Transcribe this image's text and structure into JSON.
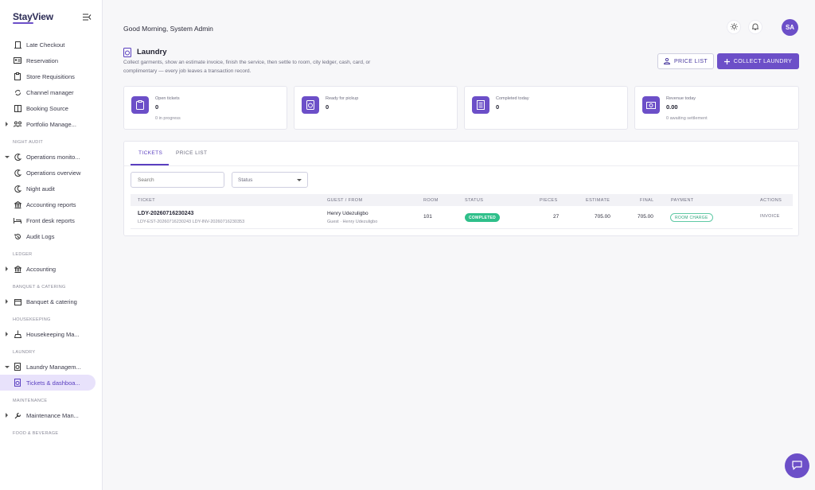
{
  "brand": {
    "logo_text": "StayView",
    "accent": "#6c4fc8"
  },
  "sidebar": {
    "top_items": [
      {
        "label": "Late Checkout",
        "icon": "door-icon"
      },
      {
        "label": "Reservation",
        "icon": "id-card-icon"
      },
      {
        "label": "Store Requisitions",
        "icon": "clipboard-icon"
      },
      {
        "label": "Channel manager",
        "icon": "sync-icon"
      },
      {
        "label": "Booking Source",
        "icon": "book-icon"
      },
      {
        "label": "Portfolio Manage...",
        "icon": "people-icon"
      }
    ],
    "sections": [
      {
        "title": "NIGHT AUDIT",
        "items": [
          {
            "label": "Operations monito...",
            "icon": "moon-icon"
          },
          {
            "label": "Operations overview",
            "icon": "moon-icon"
          },
          {
            "label": "Night audit",
            "icon": "moon-icon"
          },
          {
            "label": "Accounting reports",
            "icon": "bank-icon"
          },
          {
            "label": "Front desk reports",
            "icon": "bed-icon"
          },
          {
            "label": "Audit Logs",
            "icon": "history-icon"
          }
        ]
      },
      {
        "title": "LEDGER",
        "items": [
          {
            "label": "Accounting",
            "icon": "bank-icon"
          }
        ]
      },
      {
        "title": "BANQUET & CATERING",
        "items": [
          {
            "label": "Banquet & catering",
            "icon": "calendar-icon"
          }
        ]
      },
      {
        "title": "HOUSEKEEPING",
        "items": [
          {
            "label": "Housekeeping Ma...",
            "icon": "broom-icon"
          }
        ]
      },
      {
        "title": "LAUNDRY",
        "items": [
          {
            "label": "Laundry Managem...",
            "icon": "laundry-icon"
          },
          {
            "label": "Tickets & dashboa...",
            "icon": "laundry-icon"
          }
        ]
      },
      {
        "title": "MAINTENANCE",
        "items": [
          {
            "label": "Maintenance Man...",
            "icon": "wrench-icon"
          }
        ]
      },
      {
        "title": "FOOD & BEVERAGE",
        "items": []
      }
    ]
  },
  "header": {
    "greeting": "Good Morning, System Admin",
    "avatar_initials": "SA"
  },
  "page": {
    "title": "Laundry",
    "description": "Collect garments, show an estimate invoice, finish the service, then settle to room, city ledger, cash, card, or complimentary — every job leaves a transaction record.",
    "price_list_button": "PRICE LIST",
    "collect_button": "COLLECT LAUNDRY"
  },
  "stats": [
    {
      "label": "Open tickets",
      "value": "0",
      "sub": "0 in progress",
      "icon": "clipboard-icon"
    },
    {
      "label": "Ready for pickup",
      "value": "0",
      "sub": "",
      "icon": "laundry-icon"
    },
    {
      "label": "Completed today",
      "value": "0",
      "sub": "",
      "icon": "receipt-icon"
    },
    {
      "label": "Revenue today",
      "value": "0.00",
      "sub": "0 awaiting settlement",
      "icon": "cash-icon"
    }
  ],
  "tabs": [
    "TICKETS",
    "PRICE LIST"
  ],
  "filters": {
    "search_placeholder": "Search",
    "status_value": "Status"
  },
  "table": {
    "columns": [
      "TICKET",
      "GUEST / FROM",
      "ROOM",
      "STATUS",
      "PIECES",
      "ESTIMATE",
      "FINAL",
      "PAYMENT",
      "ACTIONS"
    ],
    "rows": [
      {
        "ticket": "LDY-20260716230243",
        "ticket_sub": "LDY-EST-20260716230243   LDY-INV-20260716230353",
        "guest": "Henry Udezuligbo",
        "guest_sub": "Guest · Henry Udezuligbo",
        "room": "101",
        "status": "COMPLETED",
        "pieces": "27",
        "estimate": "705.00",
        "final": "705.00",
        "payment": "ROOM CHARGE",
        "action": "INVOICE"
      }
    ]
  }
}
